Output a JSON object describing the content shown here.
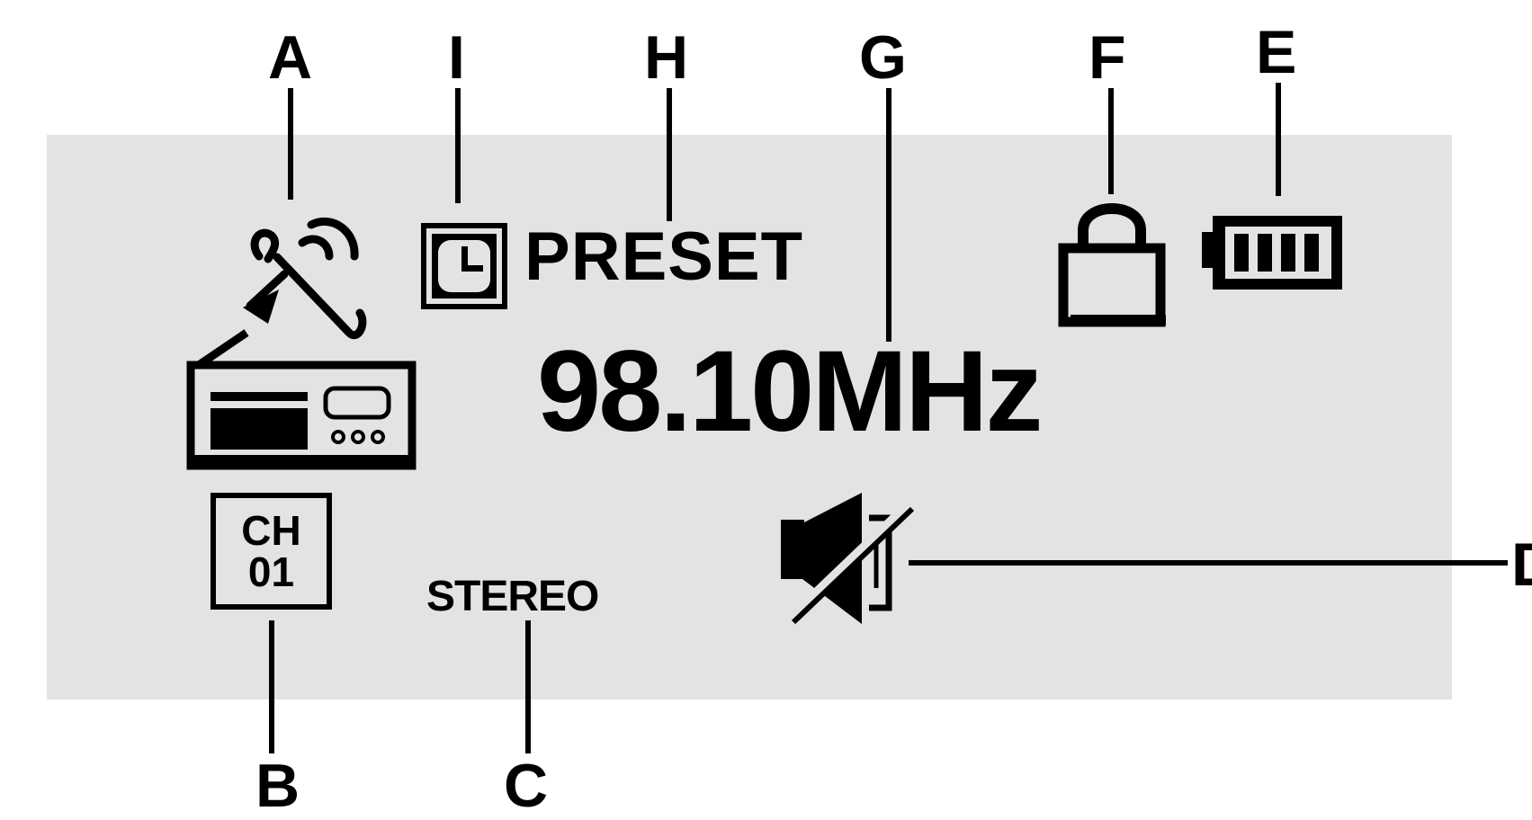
{
  "callouts": {
    "a": "A",
    "i": "I",
    "h": "H",
    "g": "G",
    "f": "F",
    "e": "E",
    "b": "B",
    "c": "C",
    "d": "D"
  },
  "display": {
    "preset_label": "PRESET",
    "frequency": "98.10MHz",
    "channel_top": "CH",
    "channel_number": "01",
    "audio_mode": "STEREO"
  },
  "icons": {
    "antenna": "satellite-signal-icon",
    "radio": "radio-icon",
    "timer": "clock-icon",
    "lock": "lock-icon",
    "battery": "battery-icon",
    "mute": "speaker-mute-icon"
  },
  "battery_level": 1.0,
  "colors": {
    "panel": "#e3e3e3",
    "ink": "#000000"
  }
}
